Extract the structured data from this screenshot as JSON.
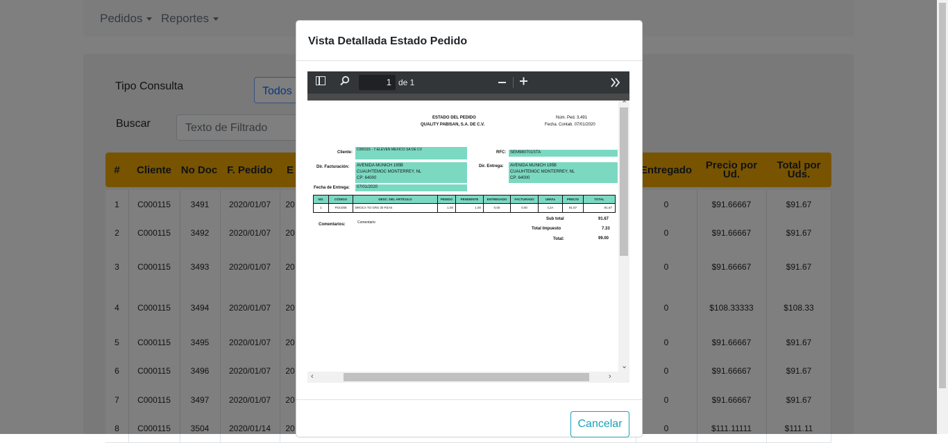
{
  "nav": {
    "item1": "Pedidos",
    "item2": "Reportes"
  },
  "filter": {
    "tipo_label": "Tipo Consulta",
    "todos": "Todos",
    "buscar_label": "Buscar",
    "search_placeholder": "Texto de Filtrado"
  },
  "table": {
    "headers": [
      "#",
      "Cliente",
      "No Doc",
      "F. Pedido",
      "E",
      "Entregado",
      "Precio por Ud.",
      "Total por Uds."
    ],
    "rows": [
      [
        "1",
        "C000115",
        "3491",
        "2020/01/07",
        "20",
        "0",
        "$91.66667",
        "$91.67"
      ],
      [
        "2",
        "C000115",
        "3492",
        "2020/01/07",
        "20",
        "0",
        "$91.66667",
        "$91.67"
      ],
      [
        "3",
        "C000115",
        "3493",
        "2020/01/07",
        "20",
        "0",
        "$91.66667",
        "$91.67"
      ],
      [
        "4",
        "C000115",
        "3494",
        "2020/01/07",
        "20",
        "0",
        "$108.33333",
        "$108.33"
      ],
      [
        "5",
        "C000115",
        "3495",
        "2020/01/07",
        "20",
        "0",
        "$91.66667",
        "$91.67"
      ],
      [
        "6",
        "C000115",
        "3496",
        "2020/01/07",
        "20",
        "0",
        "$91.66667",
        "$91.67"
      ],
      [
        "7",
        "C000115",
        "3497",
        "2020/01/07",
        "20",
        "0",
        "$91.66667",
        "$91.67"
      ],
      [
        "8",
        "C000115",
        "3504",
        "2020/01/14",
        "20",
        "0",
        "$111.11111",
        "$111.11"
      ]
    ]
  },
  "modal": {
    "title": "Vista Detallada Estado Pedido",
    "cancel": "Cancelar",
    "viewer": {
      "page": "1",
      "page_of": "de 1"
    },
    "doc": {
      "title1": "ESTADO DEL PEDIDO",
      "title2": "QUALITY PABISAN, S.A. DE C.V.",
      "num_ped": "Núm. Ped. 3,491",
      "fecha_contab": "Fecha. Contab. 07/01/2020",
      "cliente_lbl": "Cliente:",
      "cliente": "C000115 - 7-ELEVEN MEXICO SA DE CV",
      "rfc_lbl": "RFC:",
      "rfc": "SEM980701STA",
      "dir_fact_lbl": "Dir. Facturación:",
      "dir_fact_1": "AVENIDA MUNICH  195B",
      "dir_fact_2": "CUAUHTEMOC MONTERREY, NL",
      "dir_fact_3": "CP: 64000",
      "dir_ent_lbl": "Dir. Entrega:",
      "dir_ent_1": "AVENIDA MUNICH  195B",
      "dir_ent_2": "CUAUHTEMOC MONTERREY, NL",
      "dir_ent_3": "CP: 64000",
      "fecha_ent_lbl": "Fecha de Entrega:",
      "fecha_ent": "07/01/2020",
      "cols": [
        "NO.",
        "CÓDIGO",
        "DESC. DEL ARTÍCULO",
        "PEDIDO",
        "PENDIENTE",
        "ENTREGADO",
        "FACTURADO",
        "UMVta",
        "PRECIO",
        "TOTAL"
      ],
      "line": [
        "1",
        "PDC008",
        "BROCA TO GRS 30 PZAS",
        "1.00",
        "1.00",
        "0.00",
        "0.00",
        "CJA",
        "91.67",
        "91.67"
      ],
      "comentarios_lbl": "Comentarios:",
      "comentario": "Comentario",
      "subtotal_lbl": "Sub total",
      "subtotal": "91.67",
      "impuesto_lbl": "Total Impuesto",
      "impuesto": "7.33",
      "total_lbl": "Total:",
      "total": "99.00"
    }
  },
  "colors": {
    "header": "#f0a800",
    "teal": "#7bd9c2",
    "cancel": "#17a2b8"
  }
}
